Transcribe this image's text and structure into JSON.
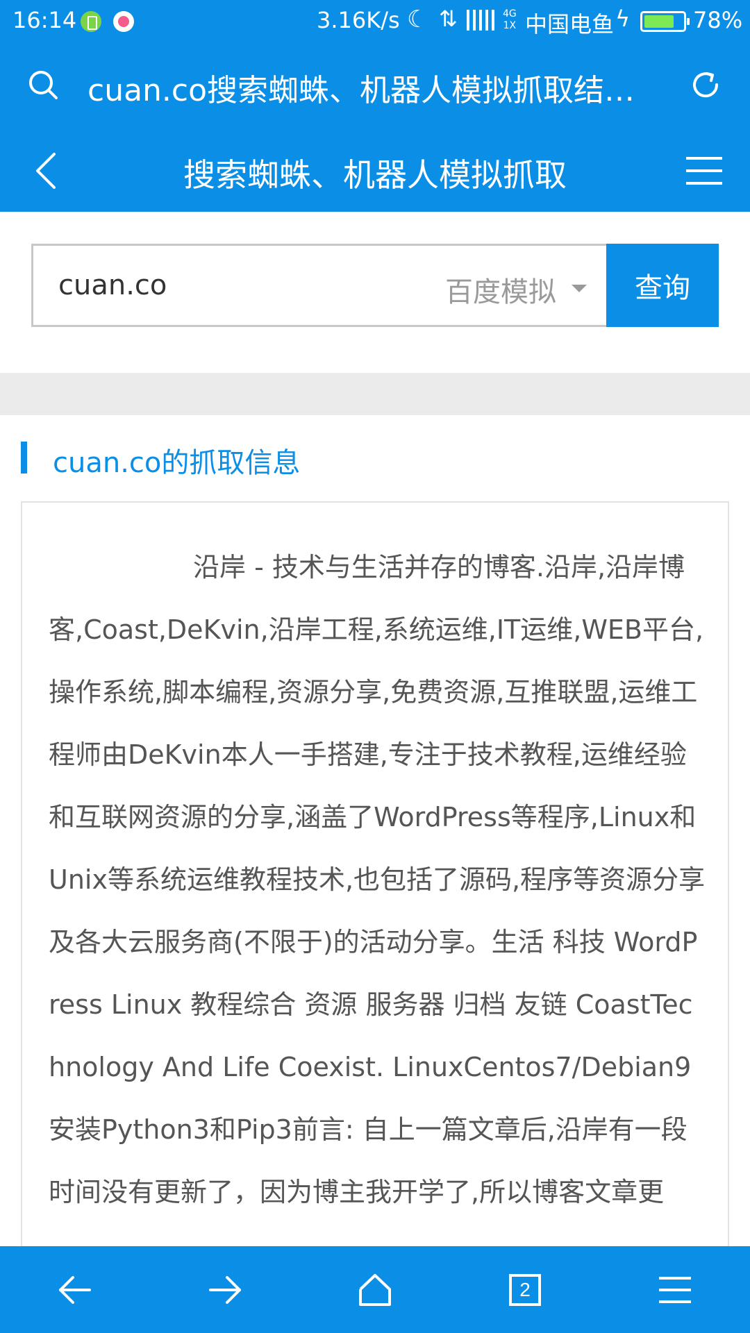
{
  "status_bar": {
    "time": "16:14",
    "net_speed": "3.16K/s",
    "net_type_top": "4G",
    "net_type_bottom": "1X",
    "carrier": "中国电鱼",
    "battery_percent": "78%",
    "battery_level": 0.78,
    "icons": [
      "battery-app-icon",
      "media-app-icon",
      "moon-icon",
      "data-arrows-icon",
      "signal-icon",
      "charging-icon",
      "battery-icon"
    ]
  },
  "address_bar": {
    "url_text": "cuan.co搜索蜘蛛、机器人模拟抓取结…",
    "icons": [
      "search-icon",
      "refresh-icon"
    ]
  },
  "header": {
    "title": "搜索蜘蛛、机器人模拟抓取",
    "icons": [
      "back-icon",
      "menu-icon"
    ]
  },
  "search_form": {
    "input_value": "cuan.co",
    "engine_selected": "百度模拟",
    "query_label": "查询"
  },
  "section": {
    "title": "cuan.co的抓取信息"
  },
  "content": {
    "text": "沿岸 - 技术与生活并存的博客.沿岸,沿岸博客,Coast,DeKvin,沿岸工程,系统运维,IT运维,WEB平台,操作系统,脚本编程,资源分享,免费资源,互推联盟,运维工程师由DeKvin本人一手搭建,专注于技术教程,运维经验和互联网资源的分享,涵盖了WordPress等程序,Linux和Unix等系统运维教程技术,也包括了源码,程序等资源分享及各大云服务商(不限于)的活动分享。生活 科技 WordPress Linux 教程综合 资源 服务器 归档 友链 CoastTechnology And Life Coexist. LinuxCentos7/Debian9安装Python3和Pip3前言: 自上一篇文章后,沿岸有一段时间没有更新了，因为博主我开学了,所以博客文章更"
  },
  "bottom_nav": {
    "tab_count": "2",
    "icons": [
      "back-arrow-icon",
      "forward-arrow-icon",
      "home-icon",
      "tabs-icon",
      "menu-icon"
    ]
  },
  "colors": {
    "brand_blue": "#0b8fe6",
    "link_blue": "#0b8fe6",
    "divider_gray": "#ebebeb",
    "body_text": "#555555"
  }
}
